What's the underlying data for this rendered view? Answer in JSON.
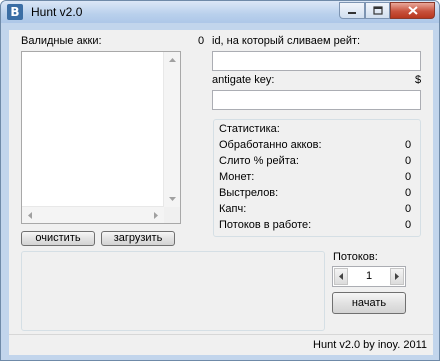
{
  "window": {
    "title": "Hunt v2.0",
    "app_icon_letter": "B"
  },
  "accounts": {
    "label": "Валидные акки:",
    "count": "0",
    "clear_button": "очистить",
    "load_button": "загрузить"
  },
  "target": {
    "label": "id, на который сливаем рейт:",
    "value": ""
  },
  "antigate": {
    "label": "antigate key:",
    "currency": "$",
    "value": ""
  },
  "stats": {
    "title": "Статистика:",
    "rows": [
      {
        "label": "Обработанно акков:",
        "value": "0"
      },
      {
        "label": "Слито % рейта:",
        "value": "0"
      },
      {
        "label": "Монет:",
        "value": "0"
      },
      {
        "label": "Выстрелов:",
        "value": "0"
      },
      {
        "label": "Капч:",
        "value": "0"
      },
      {
        "label": "Потоков в работе:",
        "value": "0"
      }
    ]
  },
  "threads": {
    "label": "Потоков:",
    "value": "1"
  },
  "start_button": "начать",
  "status_bar": {
    "text": "Hunt v2.0 by inoy. 2011"
  },
  "icons": {
    "title": "vk-logo-icon",
    "minimize": "minimize-icon",
    "maximize": "maximize-icon",
    "close": "close-icon"
  }
}
